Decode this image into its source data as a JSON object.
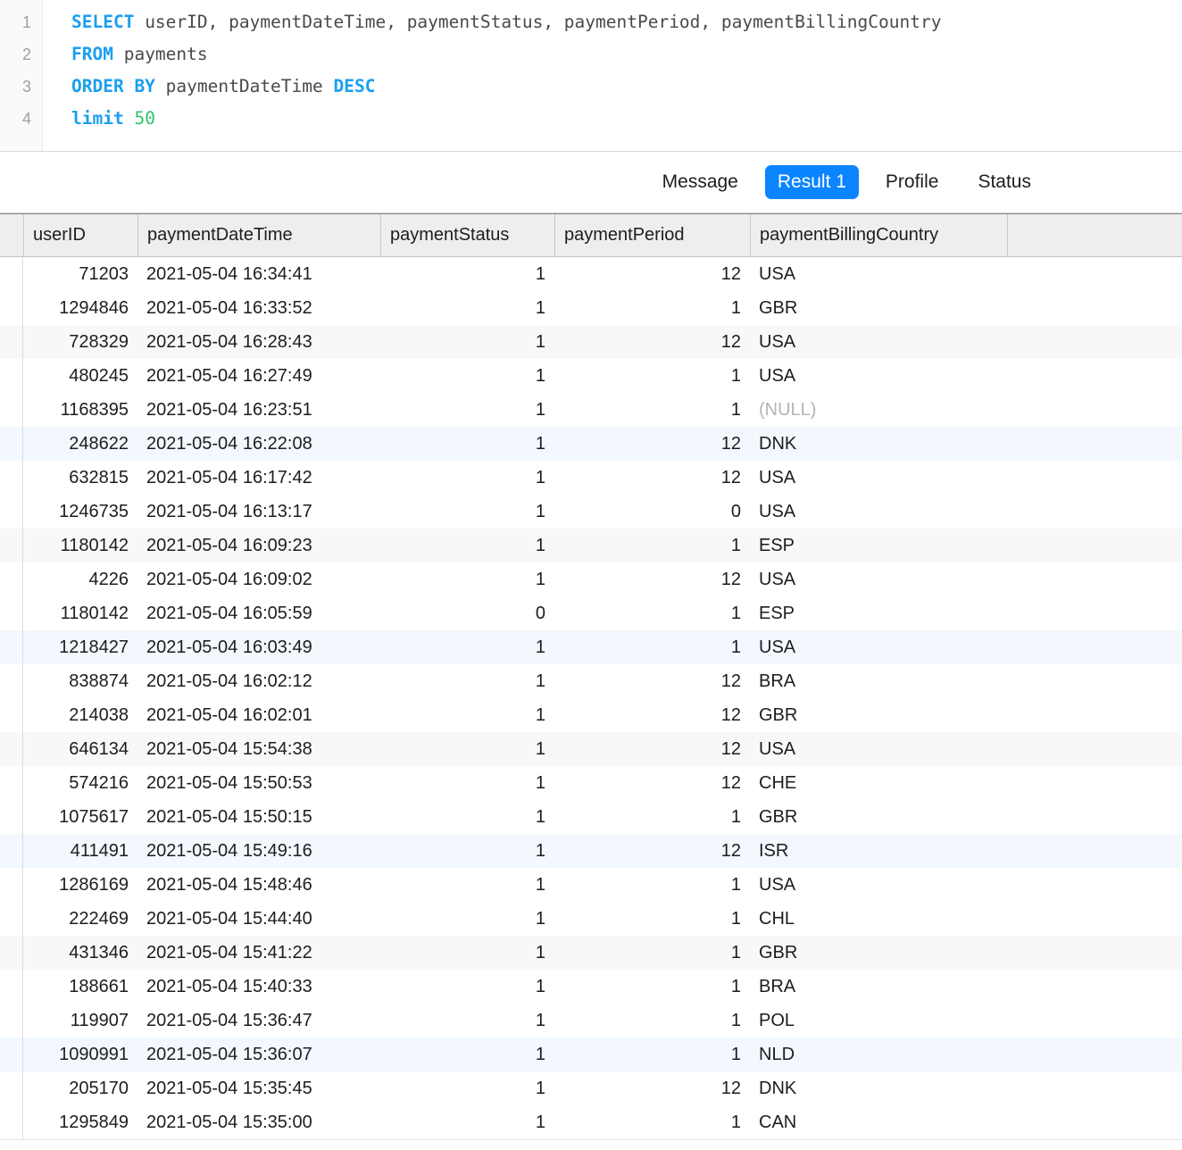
{
  "editor": {
    "lines": [
      {
        "number": "1",
        "tokens": [
          {
            "t": "SELECT",
            "k": "kw"
          },
          {
            "t": " userID, paymentDateTime, paymentStatus, paymentPeriod, paymentBillingCountry",
            "k": "id"
          }
        ]
      },
      {
        "number": "2",
        "tokens": [
          {
            "t": "FROM",
            "k": "kw"
          },
          {
            "t": " payments",
            "k": "id"
          }
        ]
      },
      {
        "number": "3",
        "tokens": [
          {
            "t": "ORDER BY",
            "k": "kw"
          },
          {
            "t": " paymentDateTime ",
            "k": "id"
          },
          {
            "t": "DESC",
            "k": "kw"
          }
        ]
      },
      {
        "number": "4",
        "tokens": [
          {
            "t": "limit",
            "k": "kw"
          },
          {
            "t": " ",
            "k": "id"
          },
          {
            "t": "50",
            "k": "num"
          }
        ]
      }
    ]
  },
  "tabs": [
    {
      "label": "Message",
      "active": false
    },
    {
      "label": "Result 1",
      "active": true
    },
    {
      "label": "Profile",
      "active": false
    },
    {
      "label": "Status",
      "active": false
    }
  ],
  "result_grid": {
    "columns": [
      {
        "name": "userID",
        "align": "right"
      },
      {
        "name": "paymentDateTime",
        "align": "left"
      },
      {
        "name": "paymentStatus",
        "align": "right"
      },
      {
        "name": "paymentPeriod",
        "align": "right"
      },
      {
        "name": "paymentBillingCountry",
        "align": "left"
      }
    ],
    "rows": [
      {
        "userID": "71203",
        "paymentDateTime": "2021-05-04 16:34:41",
        "paymentStatus": "1",
        "paymentPeriod": "12",
        "paymentBillingCountry": "USA"
      },
      {
        "userID": "1294846",
        "paymentDateTime": "2021-05-04 16:33:52",
        "paymentStatus": "1",
        "paymentPeriod": "1",
        "paymentBillingCountry": "GBR"
      },
      {
        "userID": "728329",
        "paymentDateTime": "2021-05-04 16:28:43",
        "paymentStatus": "1",
        "paymentPeriod": "12",
        "paymentBillingCountry": "USA"
      },
      {
        "userID": "480245",
        "paymentDateTime": "2021-05-04 16:27:49",
        "paymentStatus": "1",
        "paymentPeriod": "1",
        "paymentBillingCountry": "USA"
      },
      {
        "userID": "1168395",
        "paymentDateTime": "2021-05-04 16:23:51",
        "paymentStatus": "1",
        "paymentPeriod": "1",
        "paymentBillingCountry": "(NULL)",
        "null_country": true
      },
      {
        "userID": "248622",
        "paymentDateTime": "2021-05-04 16:22:08",
        "paymentStatus": "1",
        "paymentPeriod": "12",
        "paymentBillingCountry": "DNK"
      },
      {
        "userID": "632815",
        "paymentDateTime": "2021-05-04 16:17:42",
        "paymentStatus": "1",
        "paymentPeriod": "12",
        "paymentBillingCountry": "USA"
      },
      {
        "userID": "1246735",
        "paymentDateTime": "2021-05-04 16:13:17",
        "paymentStatus": "1",
        "paymentPeriod": "0",
        "paymentBillingCountry": "USA"
      },
      {
        "userID": "1180142",
        "paymentDateTime": "2021-05-04 16:09:23",
        "paymentStatus": "1",
        "paymentPeriod": "1",
        "paymentBillingCountry": "ESP"
      },
      {
        "userID": "4226",
        "paymentDateTime": "2021-05-04 16:09:02",
        "paymentStatus": "1",
        "paymentPeriod": "12",
        "paymentBillingCountry": "USA"
      },
      {
        "userID": "1180142",
        "paymentDateTime": "2021-05-04 16:05:59",
        "paymentStatus": "0",
        "paymentPeriod": "1",
        "paymentBillingCountry": "ESP"
      },
      {
        "userID": "1218427",
        "paymentDateTime": "2021-05-04 16:03:49",
        "paymentStatus": "1",
        "paymentPeriod": "1",
        "paymentBillingCountry": "USA"
      },
      {
        "userID": "838874",
        "paymentDateTime": "2021-05-04 16:02:12",
        "paymentStatus": "1",
        "paymentPeriod": "12",
        "paymentBillingCountry": "BRA"
      },
      {
        "userID": "214038",
        "paymentDateTime": "2021-05-04 16:02:01",
        "paymentStatus": "1",
        "paymentPeriod": "12",
        "paymentBillingCountry": "GBR"
      },
      {
        "userID": "646134",
        "paymentDateTime": "2021-05-04 15:54:38",
        "paymentStatus": "1",
        "paymentPeriod": "12",
        "paymentBillingCountry": "USA"
      },
      {
        "userID": "574216",
        "paymentDateTime": "2021-05-04 15:50:53",
        "paymentStatus": "1",
        "paymentPeriod": "12",
        "paymentBillingCountry": "CHE"
      },
      {
        "userID": "1075617",
        "paymentDateTime": "2021-05-04 15:50:15",
        "paymentStatus": "1",
        "paymentPeriod": "1",
        "paymentBillingCountry": "GBR"
      },
      {
        "userID": "411491",
        "paymentDateTime": "2021-05-04 15:49:16",
        "paymentStatus": "1",
        "paymentPeriod": "12",
        "paymentBillingCountry": "ISR"
      },
      {
        "userID": "1286169",
        "paymentDateTime": "2021-05-04 15:48:46",
        "paymentStatus": "1",
        "paymentPeriod": "1",
        "paymentBillingCountry": "USA"
      },
      {
        "userID": "222469",
        "paymentDateTime": "2021-05-04 15:44:40",
        "paymentStatus": "1",
        "paymentPeriod": "1",
        "paymentBillingCountry": "CHL"
      },
      {
        "userID": "431346",
        "paymentDateTime": "2021-05-04 15:41:22",
        "paymentStatus": "1",
        "paymentPeriod": "1",
        "paymentBillingCountry": "GBR"
      },
      {
        "userID": "188661",
        "paymentDateTime": "2021-05-04 15:40:33",
        "paymentStatus": "1",
        "paymentPeriod": "1",
        "paymentBillingCountry": "BRA"
      },
      {
        "userID": "119907",
        "paymentDateTime": "2021-05-04 15:36:47",
        "paymentStatus": "1",
        "paymentPeriod": "1",
        "paymentBillingCountry": "POL"
      },
      {
        "userID": "1090991",
        "paymentDateTime": "2021-05-04 15:36:07",
        "paymentStatus": "1",
        "paymentPeriod": "1",
        "paymentBillingCountry": "NLD"
      },
      {
        "userID": "205170",
        "paymentDateTime": "2021-05-04 15:35:45",
        "paymentStatus": "1",
        "paymentPeriod": "12",
        "paymentBillingCountry": "DNK"
      },
      {
        "userID": "1295849",
        "paymentDateTime": "2021-05-04 15:35:00",
        "paymentStatus": "1",
        "paymentPeriod": "1",
        "paymentBillingCountry": "CAN"
      }
    ]
  },
  "colors": {
    "accent": "#0a84ff",
    "keyword": "#1a9ff0",
    "number": "#2ec36b",
    "identifier": "#4a4a4a",
    "null_text": "#b4b4b4",
    "stripe_gray": "#f8f8f8",
    "stripe_blue": "#f2f8fd",
    "header_bg": "#eeeeee"
  }
}
